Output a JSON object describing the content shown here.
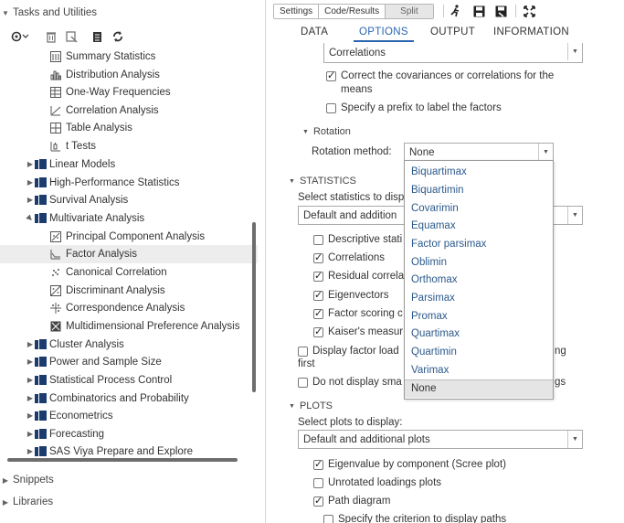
{
  "left": {
    "title": "Tasks and Utilities",
    "items": [
      "Summary Statistics",
      "Distribution Analysis",
      "One-Way Frequencies",
      "Correlation Analysis",
      "Table Analysis",
      "t Tests",
      "Linear Models",
      "High-Performance Statistics",
      "Survival Analysis",
      "Multivariate Analysis",
      "Principal Component Analysis",
      "Factor Analysis",
      "Canonical Correlation",
      "Discriminant Analysis",
      "Correspondence Analysis",
      "Multidimensional Preference Analysis",
      "Cluster Analysis",
      "Power and Sample Size",
      "Statistical Process Control",
      "Combinatorics and Probability",
      "Econometrics",
      "Forecasting",
      "SAS Viya Prepare and Explore"
    ],
    "selected": "Factor Analysis",
    "snippets": "Snippets",
    "libraries": "Libraries"
  },
  "right": {
    "view_buttons": [
      "Settings",
      "Code/Results",
      "Split"
    ],
    "tabs": [
      "DATA",
      "OPTIONS",
      "OUTPUT",
      "INFORMATION"
    ],
    "active_tab": "OPTIONS",
    "matrix_select_value": "Correlations",
    "correct_cov_label_line1": "Correct the covariances or correlations for the",
    "correct_cov_label_line2": "means",
    "prefix_label": "Specify a prefix to label the factors",
    "rotation_header": "Rotation",
    "rotation_method_label": "Rotation method:",
    "rotation_method_value": "None",
    "rotation_options": [
      "Biquartimax",
      "Biquartimin",
      "Covarimin",
      "Equamax",
      "Factor parsimax",
      "Oblimin",
      "Orthomax",
      "Parsimax",
      "Promax",
      "Quartimax",
      "Quartimin",
      "Varimax",
      "None"
    ],
    "statistics_header": "STATISTICS",
    "select_stats_label": "Select statistics to displ",
    "stats_select_value": "Default and addition",
    "stats_items": [
      "Descriptive stati",
      "Correlations",
      "Residual correla",
      "Eigenvectors",
      "Factor scoring c",
      "Kaiser's measur"
    ],
    "display_factor_load": "Display factor load",
    "display_factor_load_tail": "ng",
    "first_label": "first",
    "do_not_display": "Do not display sma",
    "do_not_display_tail": "gs",
    "plots_header": "PLOTS",
    "select_plots_label": "Select plots to display:",
    "plots_select_value": "Default and additional plots",
    "plot_items": [
      "Eigenvalue by component (Scree plot)",
      "Unrotated loadings plots",
      "Path diagram"
    ],
    "specify_criterion": "Specify the criterion to display paths"
  }
}
